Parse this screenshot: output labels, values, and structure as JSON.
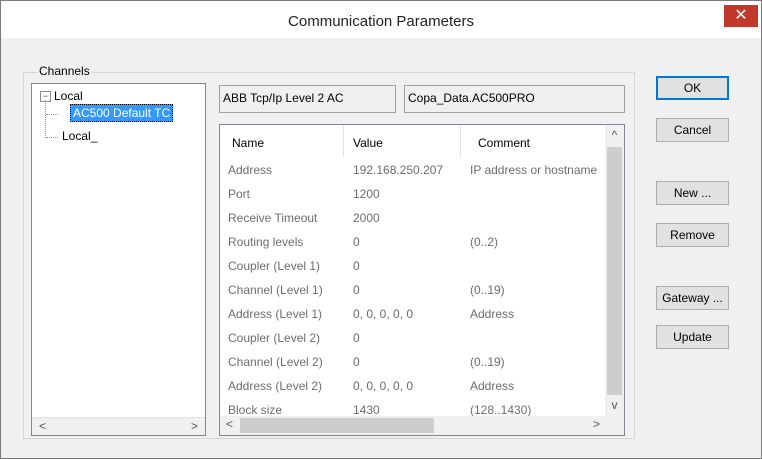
{
  "window": {
    "title": "Communication Parameters",
    "close_glyph": "✕"
  },
  "channels": {
    "group_label": "Channels",
    "tree": {
      "root": "Local",
      "children": [
        "AC500 Default TC",
        "Local_"
      ],
      "selected_index": 0
    },
    "scroll_left": "<",
    "scroll_right": ">"
  },
  "fields": {
    "driver": "ABB Tcp/Ip Level 2 AC",
    "name": "Copa_Data.AC500PRO"
  },
  "grid": {
    "columns": [
      "Name",
      "Value",
      "Comment"
    ],
    "rows": [
      [
        "Address",
        "192.168.250.207",
        "IP address or hostname"
      ],
      [
        "Port",
        "1200",
        ""
      ],
      [
        "Receive Timeout",
        "2000",
        ""
      ],
      [
        "Routing levels",
        "0",
        "(0..2)"
      ],
      [
        "Coupler (Level 1)",
        "0",
        ""
      ],
      [
        "Channel (Level 1)",
        "0",
        "(0..19)"
      ],
      [
        "Address (Level 1)",
        "0, 0, 0, 0, 0",
        "Address"
      ],
      [
        "Coupler (Level 2)",
        "0",
        ""
      ],
      [
        "Channel (Level 2)",
        "0",
        "(0..19)"
      ],
      [
        "Address (Level 2)",
        "0, 0, 0, 0, 0",
        "Address"
      ],
      [
        "Block size",
        "1430",
        "(128..1430)"
      ]
    ],
    "scroll_up": "^",
    "scroll_down": "v",
    "scroll_left": "<",
    "scroll_right": ">"
  },
  "buttons": {
    "ok": "OK",
    "cancel": "Cancel",
    "new": "New ...",
    "remove": "Remove",
    "gateway": "Gateway ...",
    "update": "Update"
  },
  "colors": {
    "selection": "#3399ff",
    "close": "#c0392b"
  }
}
